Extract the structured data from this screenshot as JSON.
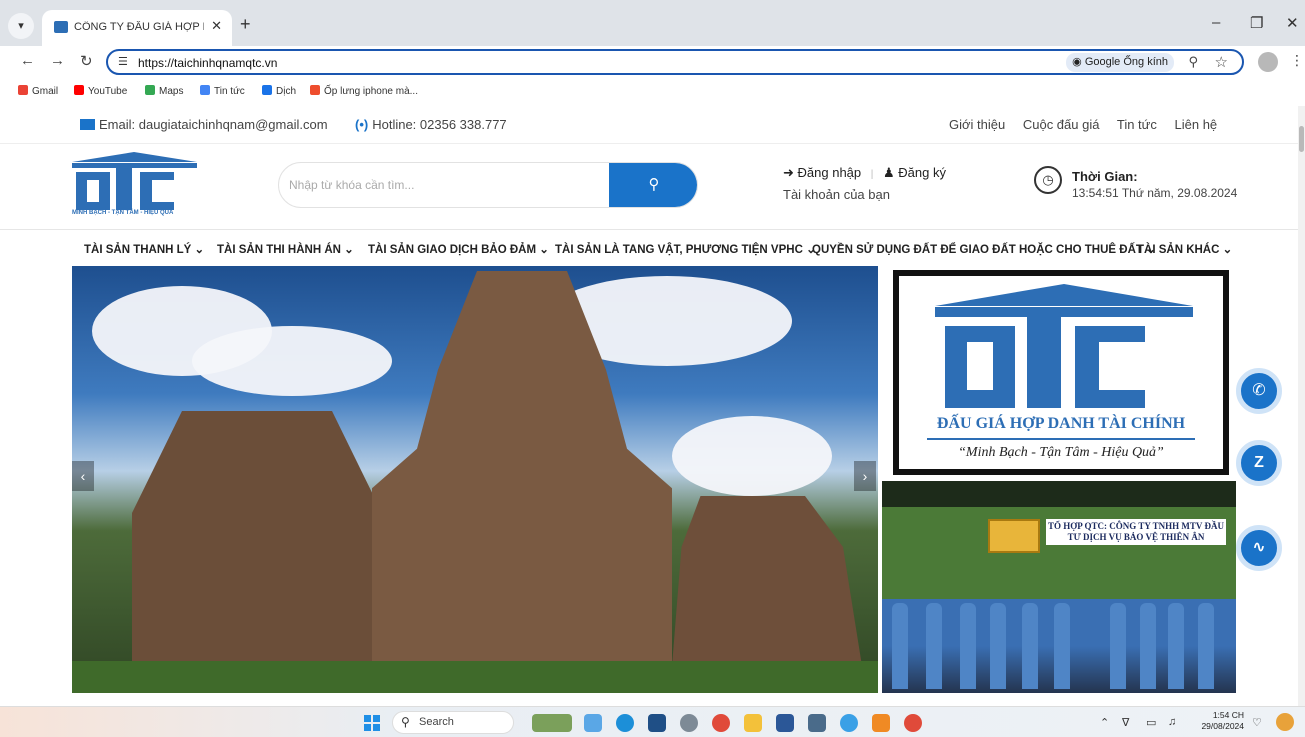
{
  "browser": {
    "tab_title": "CÔNG TY ĐẤU GIÁ HỢP DANH",
    "url": "https://taichinhqnamqtc.vn",
    "lens_label": "Google Ống kính",
    "bookmarks": [
      "Gmail",
      "YouTube",
      "Maps",
      "Tin tức",
      "Dịch",
      "Ốp lưng iphone mà..."
    ]
  },
  "topbar": {
    "email": "Email: daugiataichinhqnam@gmail.com",
    "hotline": "Hotline: 02356 338.777",
    "links": [
      "Giới thiệu",
      "Cuộc đấu giá",
      "Tin tức",
      "Liên hệ"
    ]
  },
  "header": {
    "logo_tagline": "MINH BẠCH - TẬN TÂM - HIỆU QUẢ",
    "search_placeholder": "Nhập từ khóa cần tìm...",
    "login": "Đăng nhập",
    "register": "Đăng ký",
    "account_sub": "Tài khoản của bạn",
    "time_title": "Thời Gian:",
    "time_value": "13:54:51 Thứ năm, 29.08.2024"
  },
  "categories": [
    "TÀI SẢN THANH LÝ",
    "TÀI SẢN THI HÀNH ÁN",
    "TÀI SẢN GIAO DỊCH BẢO ĐẢM",
    "TÀI SẢN LÀ TANG VẬT, PHƯƠNG TIỆN VPHC",
    "QUYỀN SỬ DỤNG ĐẤT ĐỂ GIAO ĐẤT HOẶC CHO THUÊ ĐẤT",
    "TÀI SẢN KHÁC"
  ],
  "banner1": {
    "title": "ĐẤU GIÁ HỢP DANH TÀI CHÍNH",
    "slogan": "“Minh Bạch - Tận Tâm - Hiệu Quả”"
  },
  "banner2": {
    "text": "TỔ HỢP QTC: CÔNG TY TNHH MTV ĐẦU TƯ DỊCH VỤ BẢO VỆ THIÊN ÂN"
  },
  "taskbar": {
    "search_label": "Search",
    "time": "1:54 CH",
    "date": "29/08/2024"
  },
  "colors": {
    "brand_blue": "#1a73c9",
    "logo_blue": "#2d6eb5"
  }
}
